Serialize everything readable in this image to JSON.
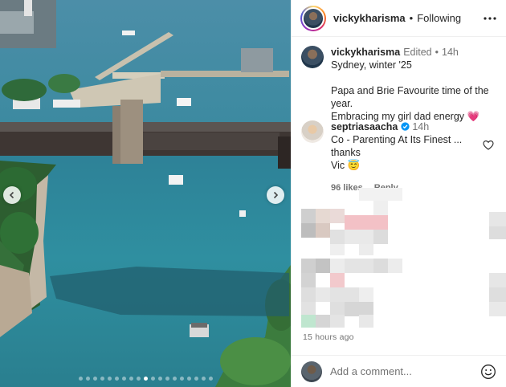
{
  "header": {
    "username": "vickykharisma",
    "separator": "•",
    "follow_status": "Following",
    "more_icon": "more-horizontal-icon"
  },
  "caption": {
    "username": "vickykharisma",
    "edited": "Edited",
    "dot": "•",
    "time": "14h",
    "lines": [
      "Sydney, winter '25",
      "",
      "Papa and Brie Favourite time of the year.",
      "Embracing my girl dad energy"
    ],
    "heart_emoji": "💗"
  },
  "comment": {
    "username": "septriasaacha",
    "time": "14h",
    "text_line1": "Co - Parenting At Its Finest ... thanks",
    "text_line2": "Vic",
    "emoji": "😇",
    "likes": "96 likes",
    "reply": "Reply",
    "verified_color": "#0095f6"
  },
  "carousel": {
    "total_slides": 19,
    "active_index": 9
  },
  "footer": {
    "time_ago": "15 hours ago",
    "comment_placeholder": "Add a comment...",
    "emoji_icon": "smiley-face-icon"
  },
  "colors": {
    "text": "#262626",
    "muted": "#737373",
    "heart": "#e1306c",
    "water": "#2f8b9c"
  }
}
